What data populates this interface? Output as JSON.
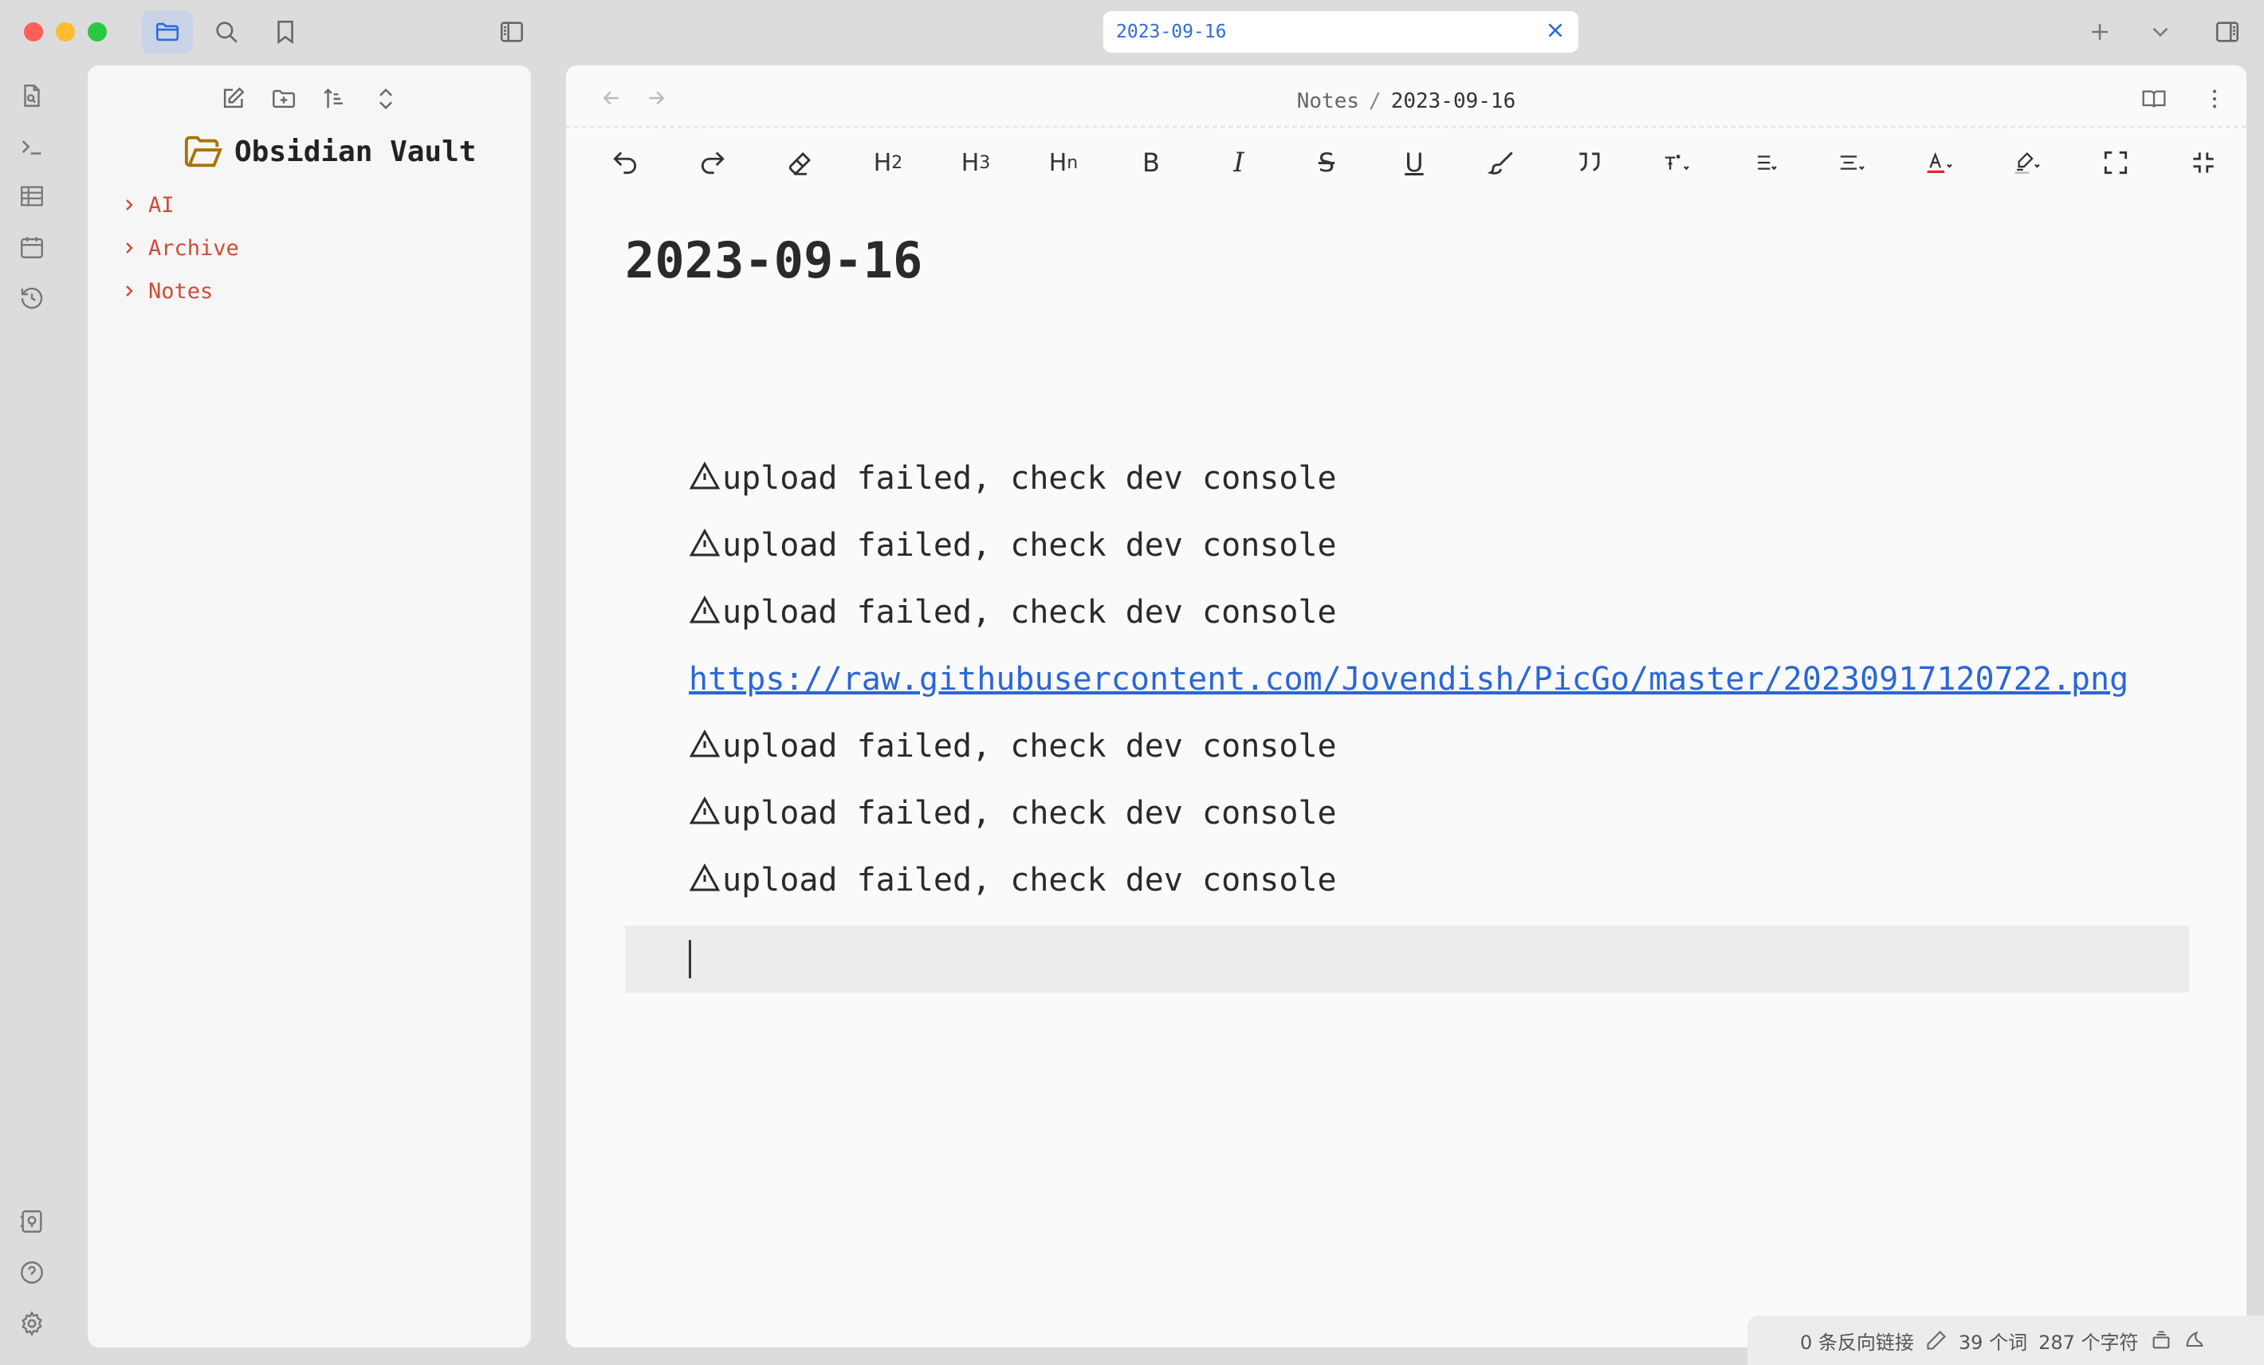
{
  "window": {
    "tab_title": "2023-09-16"
  },
  "breadcrumb": {
    "folder": "Notes",
    "separator": "/",
    "file": "2023-09-16"
  },
  "explorer": {
    "vault_name": "Obsidian Vault",
    "folders": [
      "AI",
      "Archive",
      "Notes"
    ]
  },
  "toolbar": {
    "h2": "H",
    "h2_sub": "2",
    "h3": "H",
    "h3_sub": "3",
    "hn": "H",
    "hn_sub": "n",
    "bold": "B",
    "italic": "I",
    "strike": "S",
    "underline": "U"
  },
  "document": {
    "title": "2023-09-16",
    "lines": [
      {
        "type": "error",
        "text": "upload failed, check dev console"
      },
      {
        "type": "error",
        "text": "upload failed, check dev console"
      },
      {
        "type": "error",
        "text": "upload failed, check dev console"
      },
      {
        "type": "link",
        "text": "https://raw.githubusercontent.com/Jovendish/PicGo/master/20230917120722.png"
      },
      {
        "type": "error",
        "text": "upload failed, check dev console"
      },
      {
        "type": "error",
        "text": "upload failed, check dev console"
      },
      {
        "type": "error",
        "text": "upload failed, check dev console"
      }
    ]
  },
  "status": {
    "backlinks": "0 条反向链接",
    "words": "39 个词",
    "chars": "287 个字符"
  },
  "colors": {
    "accent": "#2e6bd6",
    "folder": "#d04b37",
    "link": "#2a66d8",
    "text_color_swatch": "#d93025"
  }
}
